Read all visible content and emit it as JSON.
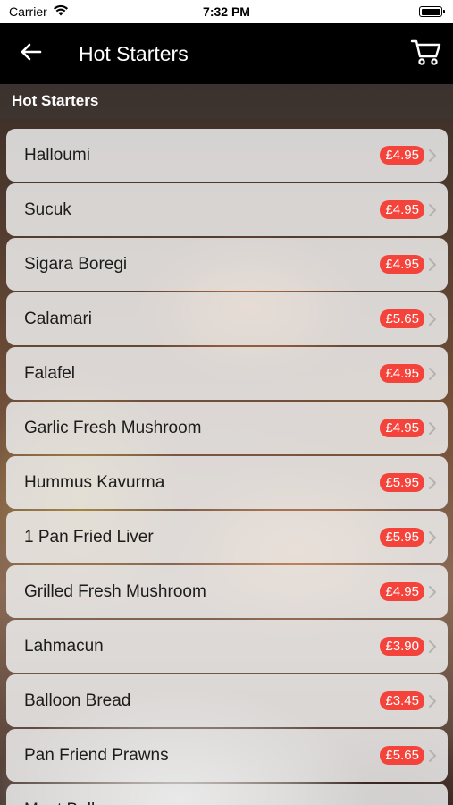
{
  "status_bar": {
    "carrier": "Carrier",
    "time": "7:32 PM"
  },
  "nav": {
    "title": "Hot Starters",
    "back_icon": "back-arrow-icon",
    "cart_icon": "cart-icon"
  },
  "section": {
    "header": "Hot Starters"
  },
  "colors": {
    "nav_bg": "#000000",
    "price_badge": "#f4433a",
    "row_bg": "#eeeeee"
  },
  "items": [
    {
      "name": "Halloumi",
      "price": "£4.95"
    },
    {
      "name": "Sucuk",
      "price": "£4.95"
    },
    {
      "name": "Sigara Boregi",
      "price": "£4.95"
    },
    {
      "name": "Calamari",
      "price": "£5.65"
    },
    {
      "name": "Falafel",
      "price": "£4.95"
    },
    {
      "name": "Garlic Fresh Mushroom",
      "price": "£4.95"
    },
    {
      "name": "Hummus Kavurma",
      "price": "£5.95"
    },
    {
      "name": "1 Pan Fried Liver",
      "price": "£5.95"
    },
    {
      "name": "Grilled Fresh Mushroom",
      "price": "£4.95"
    },
    {
      "name": "Lahmacun",
      "price": "£3.90"
    },
    {
      "name": "Balloon Bread",
      "price": "£3.45"
    },
    {
      "name": "Pan Friend Prawns",
      "price": "£5.65"
    },
    {
      "name": "Meat Balls",
      "price": ""
    }
  ]
}
